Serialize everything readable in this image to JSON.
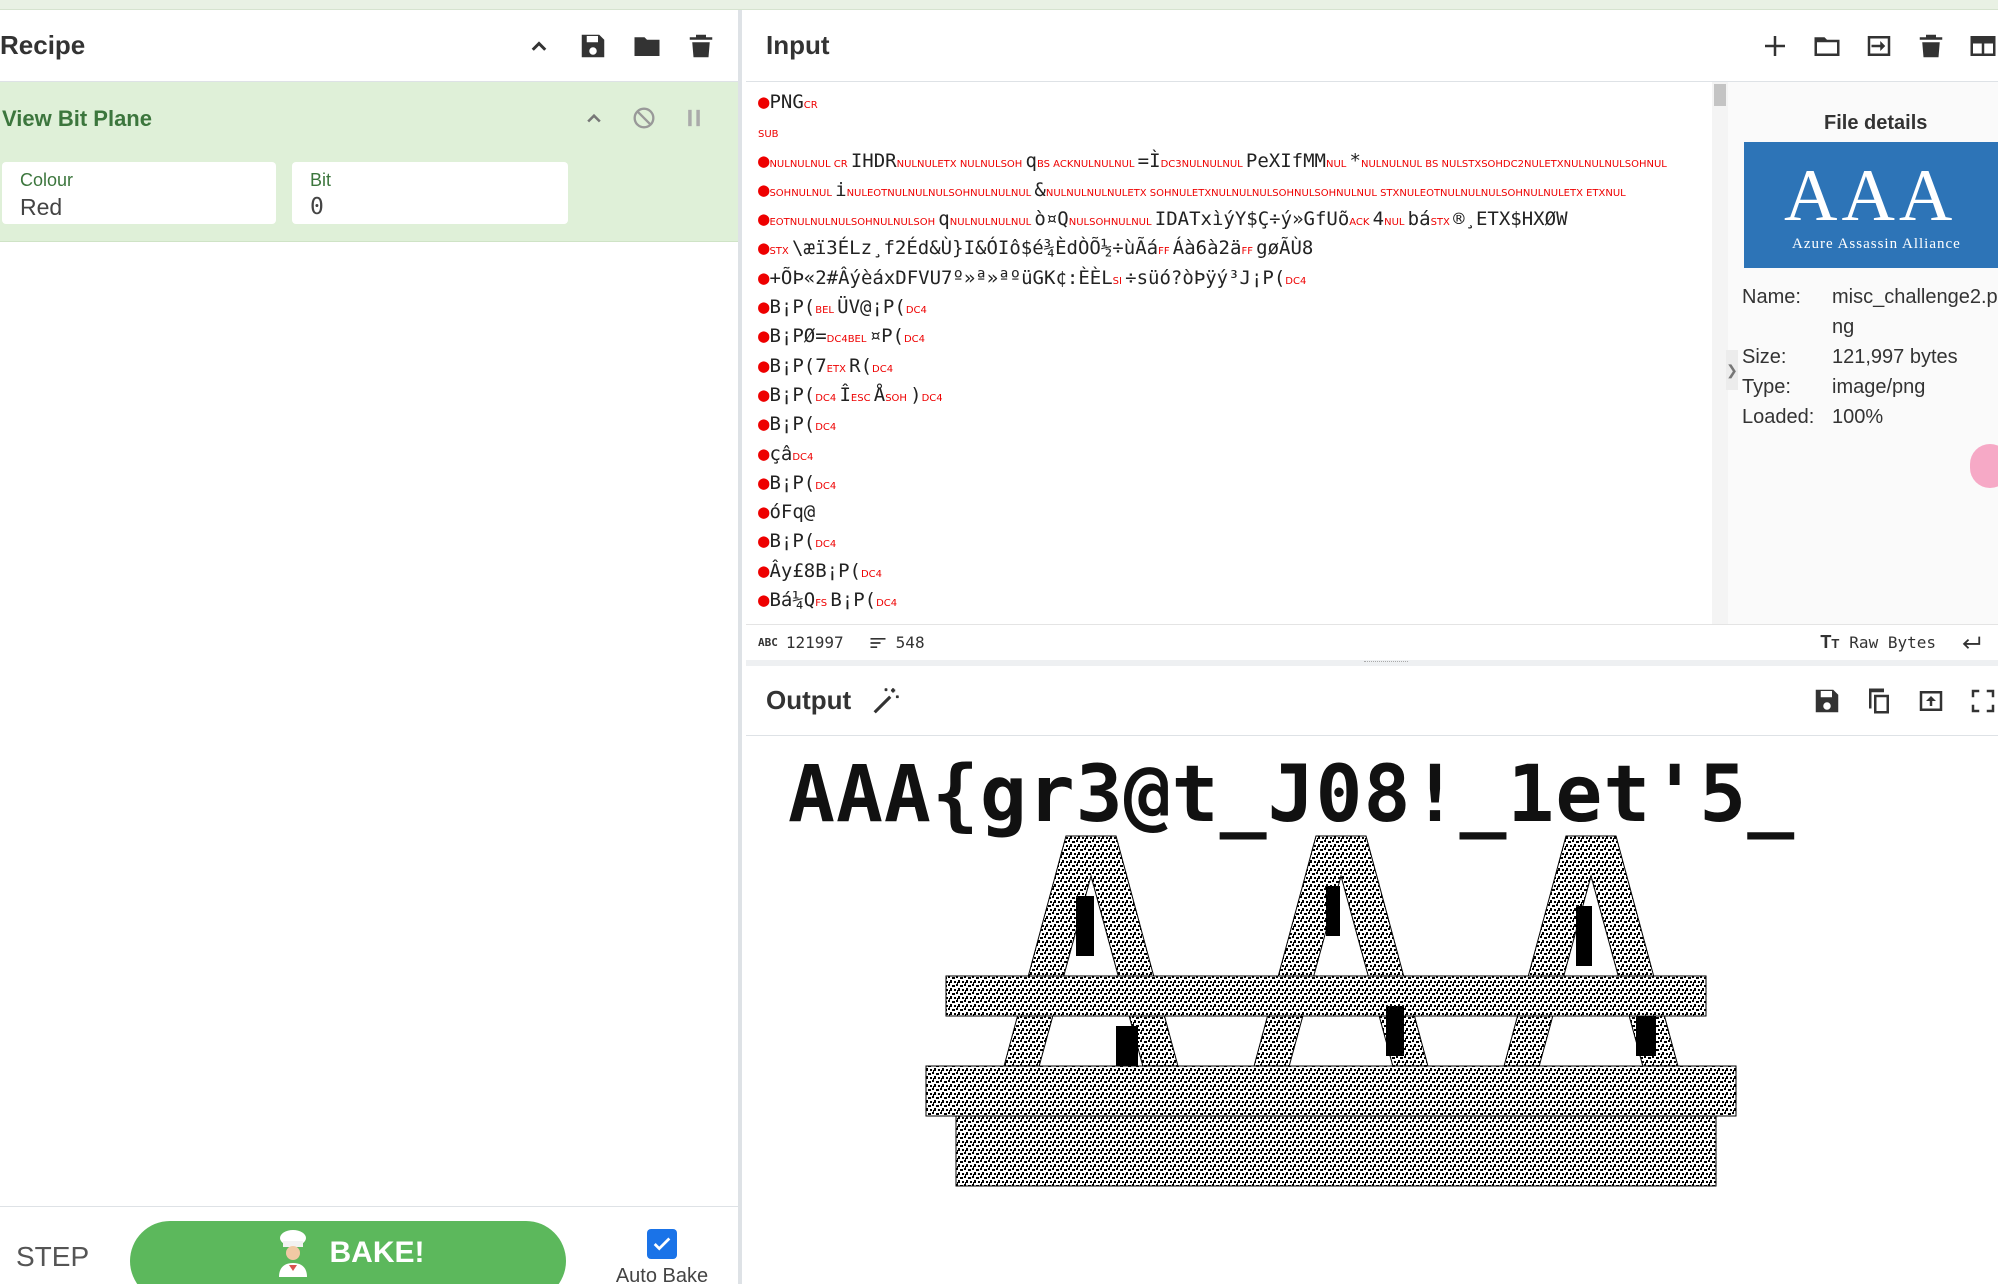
{
  "recipe": {
    "title": "Recipe",
    "operation": {
      "name": "View Bit Plane",
      "colour_label": "Colour",
      "colour_value": "Red",
      "bit_label": "Bit",
      "bit_value": "0"
    },
    "controls": {
      "step_label": "STEP",
      "bake_label": "BAKE!",
      "auto_bake_label": "Auto Bake",
      "auto_bake_checked": true
    }
  },
  "input": {
    "title": "Input",
    "lines": [
      [
        "PNG",
        "CR"
      ],
      [
        "SUB"
      ],
      [
        "NULNULNUL CR IHDR NULNULETX NULNULSOH q BS ACKNULNULNUL =Ì DC3NULNULNUL PeXIfMM NUL * NULNULNUL BS NULSTXSOHDC2NULETXNULNULNULSOHNUL"
      ],
      [
        "SOHNULNUL i NULEOTNULNULNULSOHNULNULNUL & NULNULNULNULETX SOHNULETXNULNULNULSOHNULSOHNULNUL STXNULEOTNULNULNULSOHNULNULETX ETXNUL"
      ],
      [
        "EOTNULNULNULSOHNULNULSOH q NULNULNULNUL ò¤Q NULSOHNULNUL IDATx ìýY $Ç÷ ý »GfUõ ACK 4 NUL bá STX ® ¸ETX $H X ØW"
      ],
      [
        "STX \\æ ï3 ÉLz¸f2Éd&Ù} I&Ó Iô$é¾ÈdÒÕ½÷ ù Ãá FF Á à6à2ä FF gø ÃÙ8"
      ],
      [
        "+ÕÞ«2#ÂýèáxDFVU7º»ª»ªºüGK¢: ÈÈL SI ÷sü ó?òÞÿý³J¡P( DC4"
      ],
      [
        "B¡P( BEL ÜV @¡P( DC4"
      ],
      [
        "B¡PØ= DC4BEL ¤P( DC4"
      ],
      [
        "B¡P( 7 ETX R( DC4"
      ],
      [
        "B¡P( DC4 Î ESC Å SOH ) DC4"
      ],
      [
        "B¡P( DC4"
      ],
      [
        "ç â DC4"
      ],
      [
        "B¡P( DC4"
      ],
      [
        "óFq@"
      ],
      [
        "B¡P( DC4"
      ],
      [
        "Ây£8 B¡P( DC4"
      ],
      [
        "Bá¼Q FS B¡P( DC4"
      ]
    ],
    "file_details": {
      "title": "File details",
      "thumbnail_title": "AAA",
      "thumbnail_subtitle": "Azure Assassin Alliance",
      "name_label": "Name:",
      "name_value": "misc_challenge2.png",
      "size_label": "Size:",
      "size_value": "121,997 bytes",
      "type_label": "Type:",
      "type_value": "image/png",
      "loaded_label": "Loaded:",
      "loaded_value": "100%"
    },
    "status": {
      "chars_icon": "abc-icon",
      "chars": "121997",
      "lines": "548",
      "encoding": "Raw Bytes"
    }
  },
  "output": {
    "title": "Output",
    "flag_text": "AAA{gr3@t_J08!_1et'5_",
    "image_description_icon": "bitplane-image"
  },
  "colors": {
    "accent_green": "#5cb85c",
    "op_bg": "#dff0d8",
    "op_text": "#3c763d",
    "control_char": "#ee0000",
    "thumb_blue": "#2d74b7"
  }
}
